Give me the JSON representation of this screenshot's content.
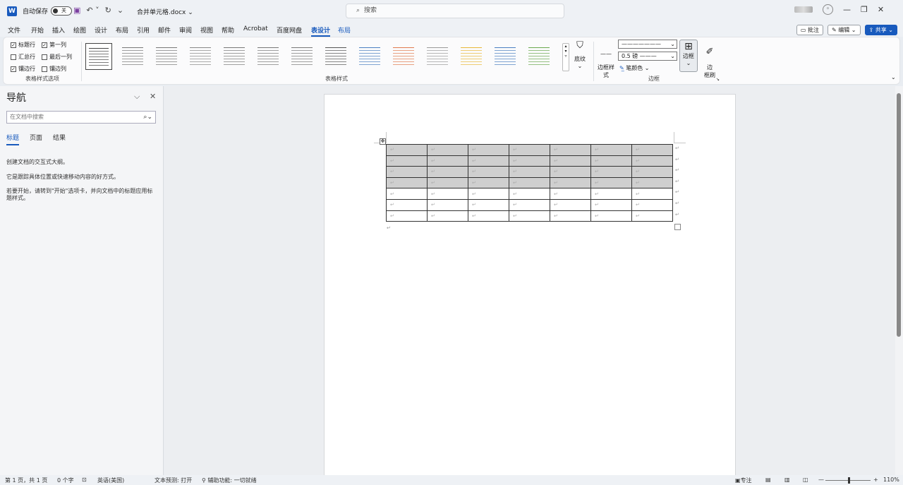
{
  "titlebar": {
    "app_icon": "W",
    "autosave_label": "自动保存",
    "autosave_state": "关",
    "undo": "↶ ˅",
    "redo": "↻",
    "customize": "⌄",
    "doc_title": "合并单元格.docx ⌄",
    "search_placeholder": "搜索",
    "minimize": "—",
    "restore": "❐",
    "close": "✕"
  },
  "menu": {
    "items": [
      "文件",
      "开始",
      "插入",
      "绘图",
      "设计",
      "布局",
      "引用",
      "邮件",
      "审阅",
      "视图",
      "帮助",
      "Acrobat",
      "百度网盘",
      "表设计",
      "布局"
    ],
    "active_index": 13,
    "comment_btn": "批注",
    "edit_btn": "编辑 ⌄",
    "share_btn": "共享 ⌄"
  },
  "ribbon": {
    "options": {
      "header_row": "标题行",
      "first_col": "第一列",
      "total_row": "汇总行",
      "last_col": "最后一列",
      "banded_rows": "镶边行",
      "banded_cols": "镶边列",
      "group_label": "表格样式选项"
    },
    "styles_label": "表格样式",
    "shading_label": "底纹",
    "border_styles_label": "边框样\n式",
    "pen_weight": "0.5 磅",
    "pen_color": "笔颜色 ⌄",
    "borders_label": "边框",
    "border_painter_label": "边\n框刷",
    "borders_group_label": "边框",
    "accent_blue": "#185abd",
    "style_colors": [
      "#444",
      "#777",
      "#777",
      "#888",
      "#777",
      "#777",
      "#777",
      "#555",
      "#4a7fc1",
      "#e07a4f",
      "#9a9a9a",
      "#e8b83a",
      "#4a7fc1",
      "#6aa84f"
    ]
  },
  "nav": {
    "title": "导航",
    "collapse": "⌵",
    "close": "✕",
    "search_placeholder": "在文档中搜索",
    "search_icon": "⌕⌄",
    "tabs": [
      "标题",
      "页面",
      "结果"
    ],
    "line1": "创建文档的交互式大纲。",
    "line2": "它是跟踪具体位置或快速移动内容的好方式。",
    "line3": "若要开始，请转到\"开始\"选项卡，并向文档中的标题应用标题样式。"
  },
  "document": {
    "cell_mark": "↵",
    "rows": 7,
    "cols": 7,
    "shaded_rows": 4
  },
  "status": {
    "page": "第 1 页，共 1 页",
    "words": "0 个字",
    "lang": "英语(美国)",
    "predict": "文本预测: 打开",
    "accessibility": "辅助功能: 一切就绪",
    "focus": "专注",
    "zoom_minus": "—",
    "zoom_plus": "+",
    "zoom": "110%"
  }
}
